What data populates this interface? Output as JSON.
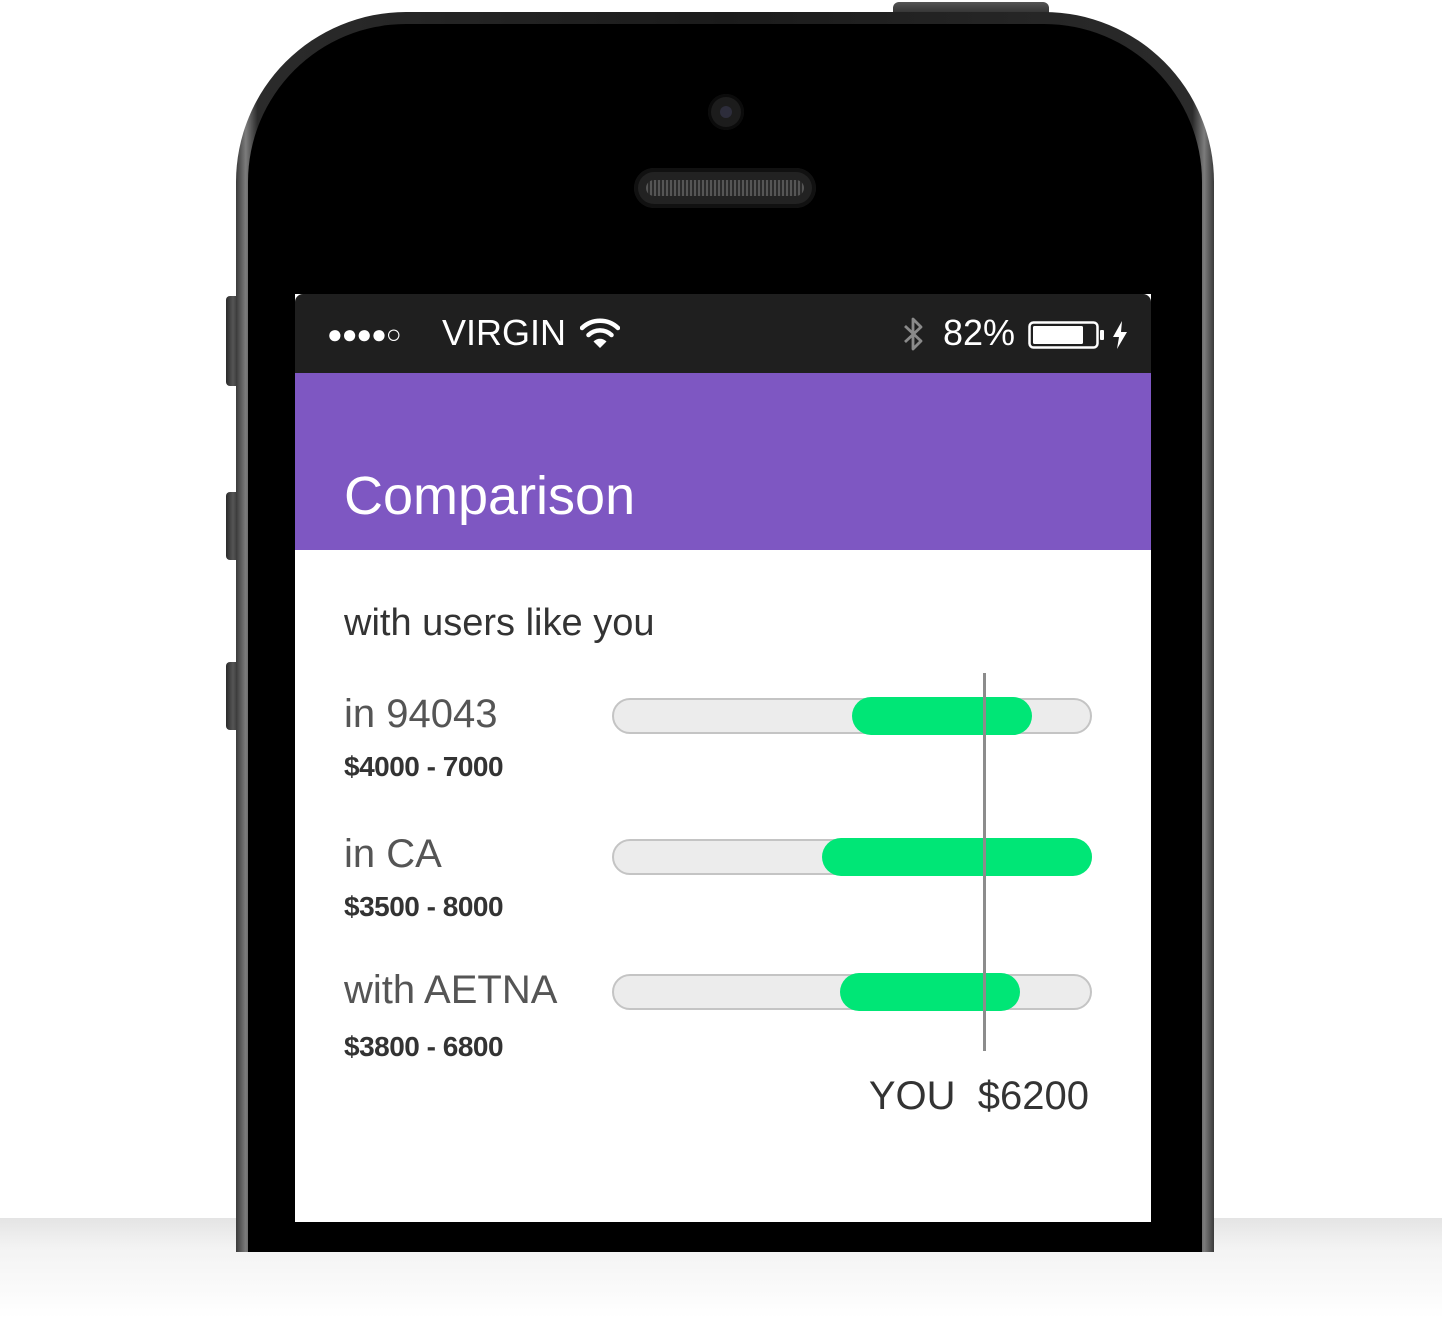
{
  "status_bar": {
    "signal_dots": "●●●●○",
    "carrier": "VIRGIN",
    "battery_percent": "82%",
    "battery_level": 0.82,
    "icons": [
      "wifi-icon",
      "bluetooth-icon",
      "battery-icon",
      "charging-bolt-icon"
    ]
  },
  "header": {
    "title": "Comparison",
    "background_color": "#7e57c2"
  },
  "comparison": {
    "subtitle": "with users like you",
    "scale": {
      "min": 0,
      "max": 8000
    },
    "rows": [
      {
        "label": "in 94043",
        "range_text": "$4000 - 7000",
        "min": 4000,
        "max": 7000
      },
      {
        "label": "in CA",
        "range_text": "$3500 - 8000",
        "min": 3500,
        "max": 8000
      },
      {
        "label": "with AETNA",
        "range_text": "$3800 - 6800",
        "min": 3800,
        "max": 6800
      }
    ],
    "you": {
      "label": "YOU",
      "amount_text": "$6200",
      "value": 6200
    },
    "bar_color": "#00e676"
  }
}
